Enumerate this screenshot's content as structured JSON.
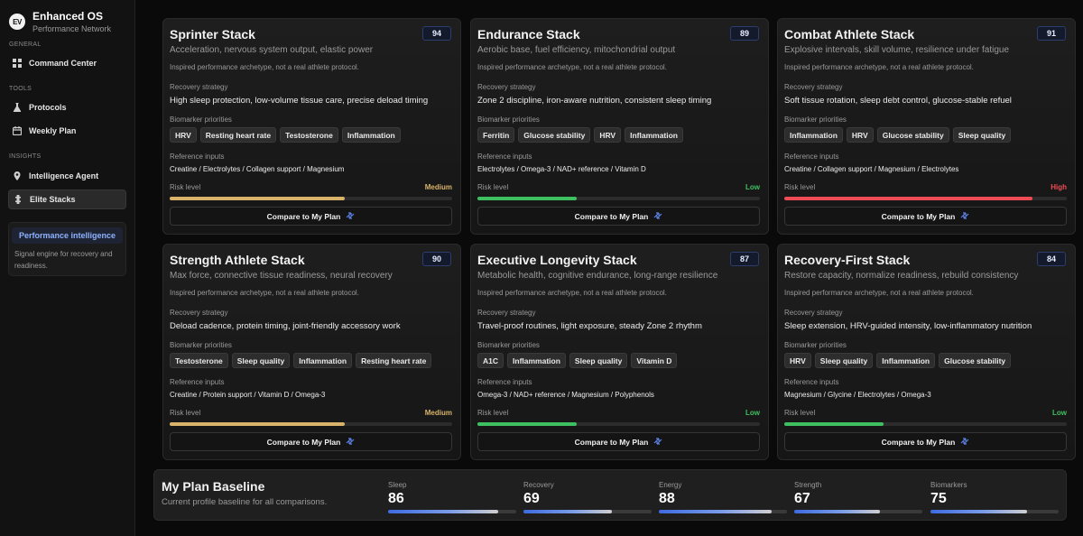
{
  "app": {
    "name": "Enhanced OS",
    "subtitle": "Performance Network",
    "logo_text": "EV"
  },
  "sidebar": {
    "sections": [
      {
        "label": "GENERAL",
        "items": [
          {
            "label": "Command Center",
            "icon": "grid-icon"
          }
        ]
      },
      {
        "label": "TOOLS",
        "items": [
          {
            "label": "Protocols",
            "icon": "flask-icon"
          },
          {
            "label": "Weekly Plan",
            "icon": "calendar-icon"
          }
        ]
      },
      {
        "label": "INSIGHTS",
        "items": [
          {
            "label": "Intelligence Agent",
            "icon": "pin-icon"
          },
          {
            "label": "Elite Stacks",
            "icon": "stack-icon",
            "active": true
          }
        ]
      }
    ],
    "perf_card": {
      "button": "Performance intelligence",
      "desc": "Signal engine for recovery and readiness."
    }
  },
  "labels": {
    "note": "Inspired performance archetype, not a real athlete protocol.",
    "strategy": "Recovery strategy",
    "biomarkers": "Biomarker priorities",
    "inputs": "Reference inputs",
    "risk": "Risk level",
    "compare": "Compare to My Plan"
  },
  "colors": {
    "medium": "#d9b36a",
    "low": "#3fc060",
    "high": "#ef4b55",
    "accent": "#8fb2ff"
  },
  "stacks": [
    {
      "title": "Sprinter Stack",
      "score": "94",
      "subtitle": "Acceleration, nervous system output, elastic power",
      "strategy": "High sleep protection, low-volume tissue care, precise deload timing",
      "biomarkers": [
        "HRV",
        "Resting heart rate",
        "Testosterone",
        "Inflammation"
      ],
      "inputs": "Creatine / Electrolytes / Collagen support / Magnesium",
      "risk": "Medium",
      "risk_level": 0.62
    },
    {
      "title": "Endurance Stack",
      "score": "89",
      "subtitle": "Aerobic base, fuel efficiency, mitochondrial output",
      "strategy": "Zone 2 discipline, iron-aware nutrition, consistent sleep timing",
      "biomarkers": [
        "Ferritin",
        "Glucose stability",
        "HRV",
        "Inflammation"
      ],
      "inputs": "Electrolytes / Omega-3 / NAD+ reference / Vitamin D",
      "risk": "Low",
      "risk_level": 0.35
    },
    {
      "title": "Combat Athlete Stack",
      "score": "91",
      "subtitle": "Explosive intervals, skill volume, resilience under fatigue",
      "strategy": "Soft tissue rotation, sleep debt control, glucose-stable refuel",
      "biomarkers": [
        "Inflammation",
        "HRV",
        "Glucose stability",
        "Sleep quality"
      ],
      "inputs": "Creatine / Collagen support / Magnesium / Electrolytes",
      "risk": "High",
      "risk_level": 0.88
    },
    {
      "title": "Strength Athlete Stack",
      "score": "90",
      "subtitle": "Max force, connective tissue readiness, neural recovery",
      "strategy": "Deload cadence, protein timing, joint-friendly accessory work",
      "biomarkers": [
        "Testosterone",
        "Sleep quality",
        "Inflammation",
        "Resting heart rate"
      ],
      "inputs": "Creatine / Protein support / Vitamin D / Omega-3",
      "risk": "Medium",
      "risk_level": 0.62
    },
    {
      "title": "Executive Longevity Stack",
      "score": "87",
      "subtitle": "Metabolic health, cognitive endurance, long-range resilience",
      "strategy": "Travel-proof routines, light exposure, steady Zone 2 rhythm",
      "biomarkers": [
        "A1C",
        "Inflammation",
        "Sleep quality",
        "Vitamin D"
      ],
      "inputs": "Omega-3 / NAD+ reference / Magnesium / Polyphenols",
      "risk": "Low",
      "risk_level": 0.35
    },
    {
      "title": "Recovery-First Stack",
      "score": "84",
      "subtitle": "Restore capacity, normalize readiness, rebuild consistency",
      "strategy": "Sleep extension, HRV-guided intensity, low-inflammatory nutrition",
      "biomarkers": [
        "HRV",
        "Sleep quality",
        "Inflammation",
        "Glucose stability"
      ],
      "inputs": "Magnesium / Glycine / Electrolytes / Omega-3",
      "risk": "Low",
      "risk_level": 0.35
    }
  ],
  "baseline": {
    "title": "My Plan Baseline",
    "subtitle": "Current profile baseline for all comparisons.",
    "metrics": [
      {
        "label": "Sleep",
        "value": "86",
        "level": 0.86
      },
      {
        "label": "Recovery",
        "value": "69",
        "level": 0.69
      },
      {
        "label": "Energy",
        "value": "88",
        "level": 0.88
      },
      {
        "label": "Strength",
        "value": "67",
        "level": 0.67
      },
      {
        "label": "Biomarkers",
        "value": "75",
        "level": 0.75
      }
    ]
  }
}
